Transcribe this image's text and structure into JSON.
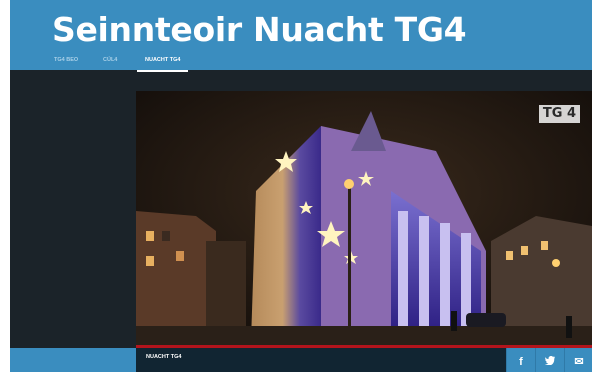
{
  "header": {
    "title": "Seinnteoir Nuacht TG4"
  },
  "nav": {
    "tabs": [
      {
        "label": "TG4 BEO"
      },
      {
        "label": "CÚL4"
      },
      {
        "label": "NUACHT TG4",
        "active": true
      }
    ]
  },
  "player": {
    "channel_logo": "TG 4"
  },
  "footer": {
    "label": "NUACHT TG4",
    "share": [
      {
        "icon": "facebook-icon",
        "glyph": "f"
      },
      {
        "icon": "twitter-icon",
        "glyph": "t"
      },
      {
        "icon": "email-icon",
        "glyph": "✉"
      }
    ]
  },
  "colors": {
    "header_blue": "#3a8dbf",
    "background": "#1b2329",
    "progress_red": "#b3141c",
    "footer_dark": "#112532"
  }
}
